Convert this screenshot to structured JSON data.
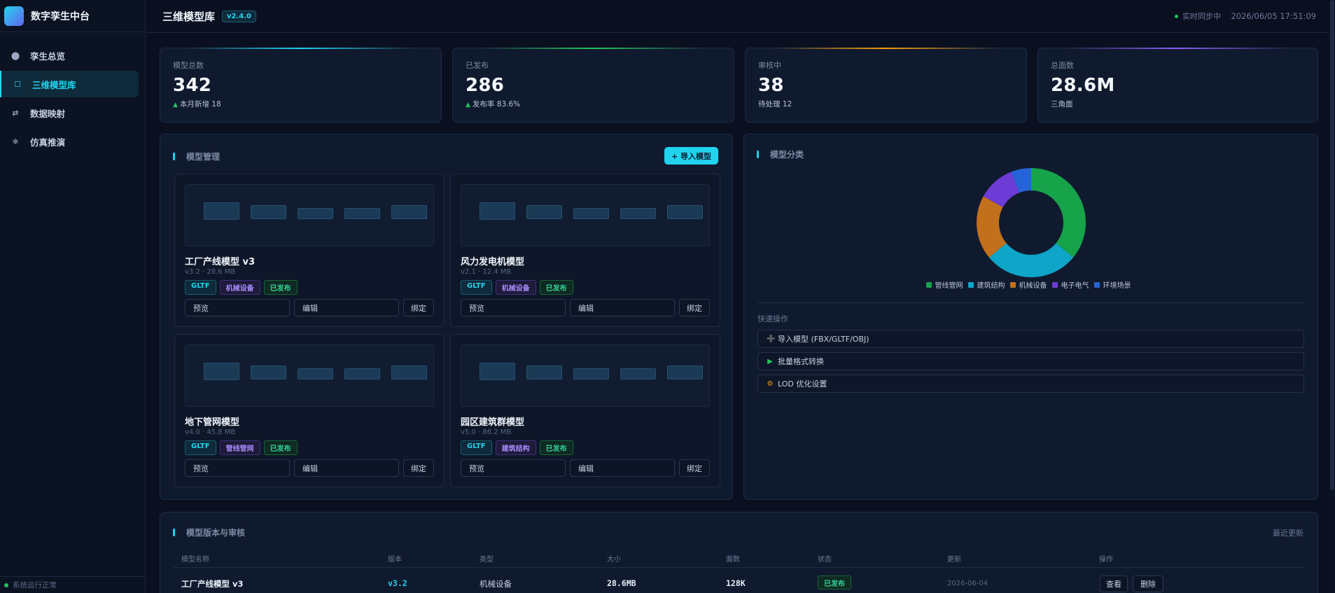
{
  "brand": {
    "title": "数字孪生中台"
  },
  "nav": [
    {
      "label": "孪生总览",
      "icon": "circle-icon"
    },
    {
      "label": "三维模型库",
      "icon": "square-icon",
      "active": true
    },
    {
      "label": "数据映射",
      "icon": "swap-icon"
    },
    {
      "label": "仿真推演",
      "icon": "snowflake-icon"
    }
  ],
  "system_status": "系统运行正常",
  "header": {
    "title": "三维模型库",
    "version": "v2.4.0",
    "sync": "实时同步中",
    "datetime": "2026/06/05 17:51:09"
  },
  "stats": [
    {
      "label": "模型总数",
      "value": "342",
      "sub_prefix": "▲",
      "sub": "本月新增 18",
      "accent": "#22d3ee"
    },
    {
      "label": "已发布",
      "value": "286",
      "sub_prefix": "▲",
      "sub": "发布率 83.6%",
      "accent": "#22c55e"
    },
    {
      "label": "审核中",
      "value": "38",
      "sub_prefix": "",
      "sub": "待处理 12",
      "accent": "#f59e0b"
    },
    {
      "label": "总面数",
      "value": "28.6M",
      "sub_prefix": "",
      "sub": "三角面",
      "accent": "#8b5cf6"
    }
  ],
  "model_panel": {
    "title": "模型管理",
    "import_button": "+ 导入模型",
    "cards": [
      {
        "name": "工厂产线模型 v3",
        "meta": "v3.2 · 28.6 MB",
        "format": "GLTF",
        "category": "机械设备",
        "status": "已发布",
        "preview": "预览",
        "edit": "编辑",
        "bind": "绑定"
      },
      {
        "name": "风力发电机模型",
        "meta": "v2.1 · 12.4 MB",
        "format": "GLTF",
        "category": "机械设备",
        "status": "已发布",
        "preview": "预览",
        "edit": "编辑",
        "bind": "绑定"
      },
      {
        "name": "地下管网模型",
        "meta": "v4.0 · 45.8 MB",
        "format": "GLTF",
        "category": "管线管网",
        "status": "已发布",
        "preview": "预览",
        "edit": "编辑",
        "bind": "绑定"
      },
      {
        "name": "园区建筑群模型",
        "meta": "v5.0 · 86.2 MB",
        "format": "GLTF",
        "category": "建筑结构",
        "status": "已发布",
        "preview": "预览",
        "edit": "编辑",
        "bind": "绑定"
      }
    ]
  },
  "category_panel": {
    "title": "模型分类",
    "legend": [
      {
        "name": "管线管网",
        "color": "#16a34a"
      },
      {
        "name": "建筑结构",
        "color": "#0ea5c9"
      },
      {
        "name": "机械设备",
        "color": "#c2701b"
      },
      {
        "name": "电子电气",
        "color": "#6d3bd6"
      },
      {
        "name": "环境场景",
        "color": "#2563d8"
      }
    ],
    "quick_title": "快速操作",
    "quick_actions": [
      {
        "icon": "plus-icon",
        "glyph": "➕",
        "color": "#9aa8c2",
        "label": "导入模型 (FBX/GLTF/OBJ)"
      },
      {
        "icon": "play-icon",
        "glyph": "▶",
        "color": "#22c55e",
        "label": "批量格式转换"
      },
      {
        "icon": "gear-icon",
        "glyph": "⚙",
        "color": "#f59e0b",
        "label": "LOD 优化设置"
      }
    ]
  },
  "chart_data": {
    "type": "pie",
    "categories": [
      "管线管网",
      "建筑结构",
      "机械设备",
      "电子电气",
      "环境场景"
    ],
    "values": [
      36,
      28,
      19,
      11,
      6
    ],
    "colors": [
      "#16a34a",
      "#0ea5c9",
      "#c2701b",
      "#6d3bd6",
      "#2563d8"
    ],
    "legend": "bottom"
  },
  "table_panel": {
    "title": "模型版本与审核",
    "recent": "最近更新",
    "columns": [
      "模型名称",
      "版本",
      "类型",
      "大小",
      "面数",
      "状态",
      "更新",
      "操作"
    ],
    "rows": [
      {
        "name": "工厂产线模型 v3",
        "version": "v3.2",
        "type": "机械设备",
        "size": "28.6MB",
        "faces": "128K",
        "status": "已发布",
        "updated": "2026-06-04",
        "view": "查看",
        "delete": "删除"
      }
    ]
  }
}
